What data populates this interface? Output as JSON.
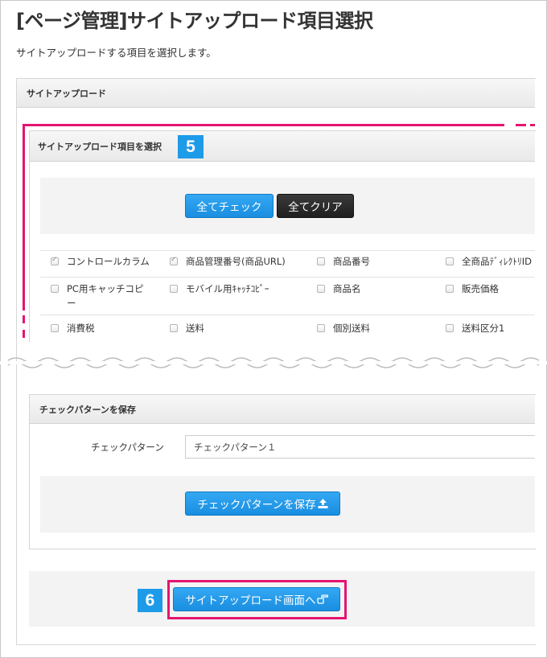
{
  "page": {
    "title": "[ページ管理]サイトアップロード項目選択",
    "description": "サイトアップロードする項目を選択します。"
  },
  "upload_panel": {
    "header": "サイトアップロード"
  },
  "select_panel": {
    "header": "サイトアップロード項目を選択",
    "badge": "5",
    "check_all": "全てチェック",
    "clear_all": "全てクリア",
    "items": [
      {
        "label": "コントロールカラム",
        "checked": true
      },
      {
        "label": "商品管理番号(商品URL)",
        "checked": true
      },
      {
        "label": "商品番号",
        "checked": false
      },
      {
        "label": "全商品ﾃﾞｨﾚｸﾄﾘID",
        "checked": false
      },
      {
        "label": "PC用キャッチコピ",
        "label_line2": "ー",
        "checked": false
      },
      {
        "label": "モバイル用ｷｬｯﾁｺﾋﾟｰ",
        "checked": false
      },
      {
        "label": "商品名",
        "checked": false
      },
      {
        "label": "販売価格",
        "checked": false
      },
      {
        "label": "消費税",
        "checked": false
      },
      {
        "label": "送料",
        "checked": false
      },
      {
        "label": "個別送料",
        "checked": false
      },
      {
        "label": "送料区分1",
        "checked": false
      }
    ]
  },
  "pattern_panel": {
    "header": "チェックパターンを保存",
    "field_label": "チェックパターン",
    "field_value": "チェックパターン１",
    "save_button": "チェックパターンを保存"
  },
  "footer": {
    "badge": "6",
    "go_button": "サイトアップロード画面へ"
  },
  "colors": {
    "highlight": "#e4156f",
    "badge": "#1e9be8",
    "button": "#1a8ee0"
  },
  "icons": {
    "save": "upload-icon",
    "go": "hand-pointer-icon"
  }
}
